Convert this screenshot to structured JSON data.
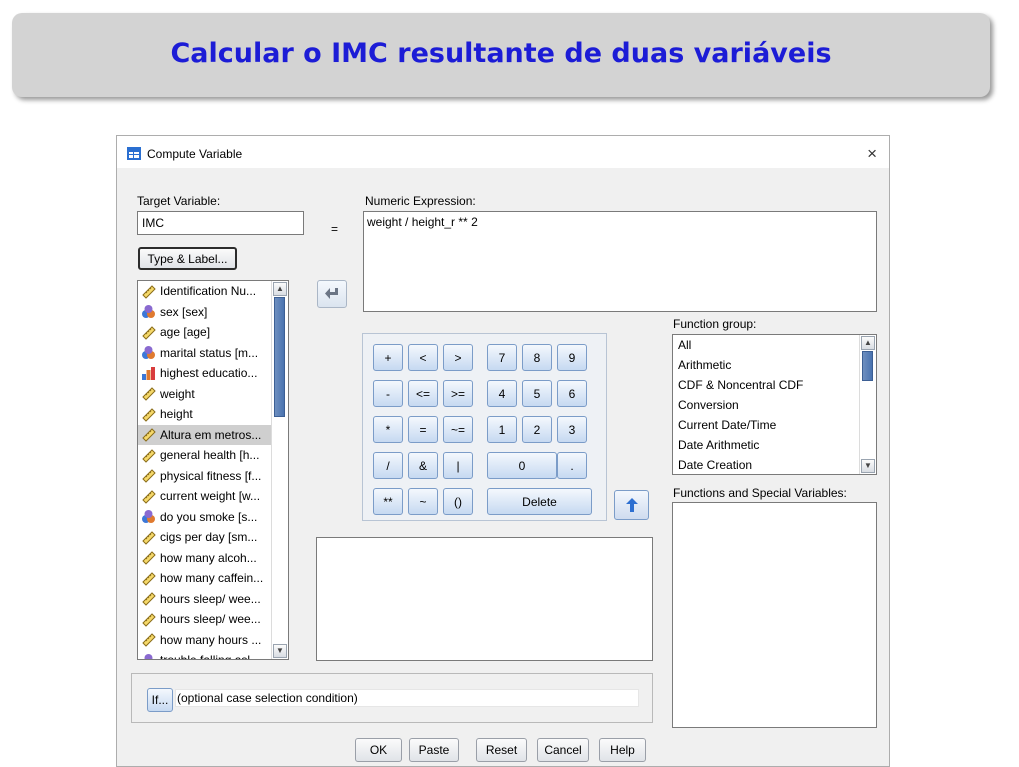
{
  "slide": {
    "title": "Calcular o IMC resultante de duas variáveis"
  },
  "window": {
    "title": "Compute Variable",
    "close": "×"
  },
  "target": {
    "label": "Target Variable:",
    "value": "IMC"
  },
  "equals": "=",
  "type_label_button": "Type & Label...",
  "expression": {
    "label": "Numeric Expression:",
    "value": "weight / height_r ** 2"
  },
  "variables": [
    {
      "label": "Identification Nu...",
      "icon": "ruler-icon"
    },
    {
      "label": "sex [sex]",
      "icon": "nominal-icon"
    },
    {
      "label": "age [age]",
      "icon": "ruler-icon"
    },
    {
      "label": "marital status [m...",
      "icon": "nominal-icon"
    },
    {
      "label": "highest educatio...",
      "icon": "ordinal-icon"
    },
    {
      "label": "weight",
      "icon": "ruler-icon"
    },
    {
      "label": "height",
      "icon": "ruler-icon"
    },
    {
      "label": "Altura em metros...",
      "icon": "ruler-icon",
      "selected": true
    },
    {
      "label": "general health [h...",
      "icon": "ruler-icon"
    },
    {
      "label": "physical fitness [f...",
      "icon": "ruler-icon"
    },
    {
      "label": "current weight [w...",
      "icon": "ruler-icon"
    },
    {
      "label": "do you smoke [s...",
      "icon": "nominal-icon"
    },
    {
      "label": "cigs per day [sm...",
      "icon": "ruler-icon"
    },
    {
      "label": "how many alcoh...",
      "icon": "ruler-icon"
    },
    {
      "label": "how many caffein...",
      "icon": "ruler-icon"
    },
    {
      "label": "hours sleep/ wee...",
      "icon": "ruler-icon"
    },
    {
      "label": "hours sleep/ wee...",
      "icon": "ruler-icon"
    },
    {
      "label": "how many hours ...",
      "icon": "ruler-icon"
    },
    {
      "label": "trouble falling asl...",
      "icon": "nominal-icon"
    }
  ],
  "calculator": {
    "rows": [
      [
        {
          "t": "+",
          "n": "plus"
        },
        {
          "t": "<",
          "n": "less"
        },
        {
          "t": ">",
          "n": "greater"
        },
        {
          "t": "7",
          "n": "7"
        },
        {
          "t": "8",
          "n": "8"
        },
        {
          "t": "9",
          "n": "9"
        }
      ],
      [
        {
          "t": "-",
          "n": "minus"
        },
        {
          "t": "<=",
          "n": "less-equal"
        },
        {
          "t": ">=",
          "n": "greater-equal"
        },
        {
          "t": "4",
          "n": "4"
        },
        {
          "t": "5",
          "n": "5"
        },
        {
          "t": "6",
          "n": "6"
        }
      ],
      [
        {
          "t": "*",
          "n": "multiply"
        },
        {
          "t": "=",
          "n": "equal"
        },
        {
          "t": "~=",
          "n": "not-equal"
        },
        {
          "t": "1",
          "n": "1"
        },
        {
          "t": "2",
          "n": "2"
        },
        {
          "t": "3",
          "n": "3"
        }
      ],
      [
        {
          "t": "/",
          "n": "divide"
        },
        {
          "t": "&",
          "n": "and"
        },
        {
          "t": "|",
          "n": "or"
        },
        {
          "t": "0",
          "n": "0",
          "wide": true
        },
        {
          "t": ".",
          "n": "decimal"
        }
      ],
      [
        {
          "t": "**",
          "n": "power"
        },
        {
          "t": "~",
          "n": "not"
        },
        {
          "t": "()",
          "n": "parentheses"
        },
        {
          "t": "Delete",
          "n": "delete",
          "wide": true
        }
      ]
    ]
  },
  "function_group": {
    "label": "Function group:",
    "items": [
      "All",
      "Arithmetic",
      "CDF & Noncentral CDF",
      "Conversion",
      "Current Date/Time",
      "Date Arithmetic",
      "Date Creation"
    ]
  },
  "functions_label": "Functions and Special Variables:",
  "if_button": "If...",
  "condition_text": "(optional case selection condition)",
  "buttons": {
    "ok": "OK",
    "paste": "Paste",
    "reset": "Reset",
    "cancel": "Cancel",
    "help": "Help"
  },
  "colors": {
    "title": "#1c1cd6",
    "banner": "#d3d3d3",
    "accent": "#2d6fd1"
  }
}
